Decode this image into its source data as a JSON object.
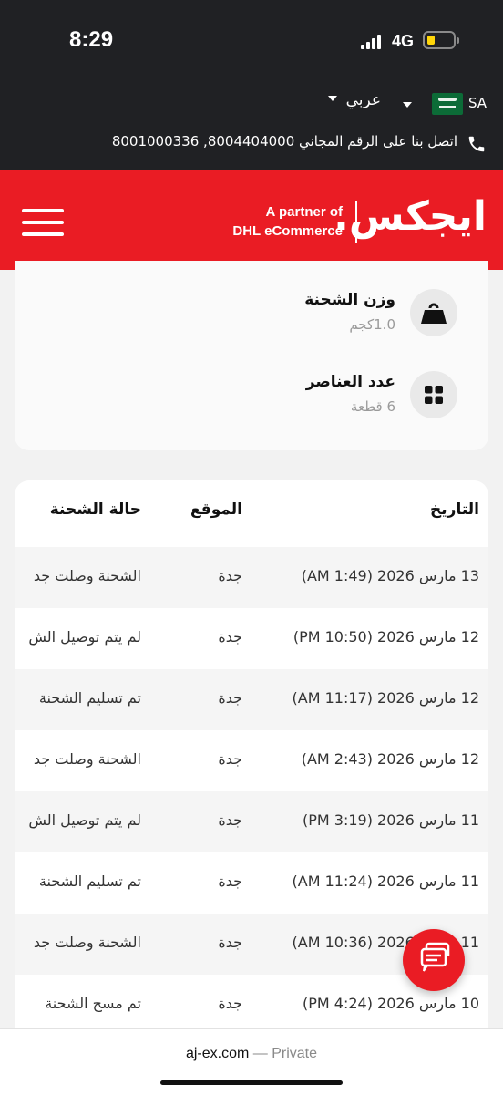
{
  "status_bar": {
    "time": "8:29",
    "network": "4G"
  },
  "top_bar": {
    "country_code": "SA",
    "language": "عربي",
    "contact_text": "اتصل بنا على الرقم المجاني 8004404000, 8001000336"
  },
  "header": {
    "logo": "ايجكس.",
    "partner_line1": "A partner of",
    "partner_line2": "DHL eCommerce",
    "brand_color": "#ea1c24"
  },
  "shipment_info": {
    "weight_label": "وزن الشحنة",
    "weight_value": "1.0كجم",
    "items_label": "عدد العناصر",
    "items_value": "6 قطعة"
  },
  "history": {
    "columns": {
      "date": "التاريخ",
      "location": "الموقع",
      "status": "حالة الشحنة"
    },
    "rows": [
      {
        "date": "13 مارس 2026 (1:49 AM)",
        "location": "جدة",
        "status": "الشحنة وصلت جد"
      },
      {
        "date": "12 مارس 2026 (10:50 PM)",
        "location": "جدة",
        "status": "لم يتم توصيل الش"
      },
      {
        "date": "12 مارس 2026 (11:17 AM)",
        "location": "جدة",
        "status": "تم تسليم الشحنة"
      },
      {
        "date": "12 مارس 2026 (2:43 AM)",
        "location": "جدة",
        "status": "الشحنة وصلت جد"
      },
      {
        "date": "11 مارس 2026 (3:19 PM)",
        "location": "جدة",
        "status": "لم يتم توصيل الش"
      },
      {
        "date": "11 مارس 2026 (11:24 AM)",
        "location": "جدة",
        "status": "تم تسليم الشحنة"
      },
      {
        "date": "11 مارس 2026 (10:36 AM)",
        "location": "جدة",
        "status": "الشحنة وصلت جد"
      },
      {
        "date": "10 مارس 2026 (4:24 PM)",
        "location": "جدة",
        "status": "تم مسح الشحنة"
      }
    ]
  },
  "browser": {
    "domain": "aj-ex.com",
    "mode": "— Private"
  }
}
